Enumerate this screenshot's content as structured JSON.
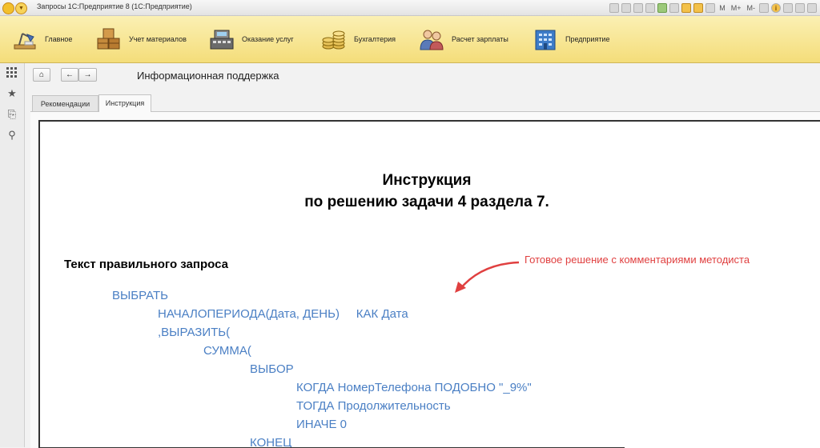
{
  "window": {
    "title": "Запросы 1С:Предприятие 8  (1С:Предприятие)",
    "menu_glyph": "▼",
    "m_label": "M",
    "m_plus_label": "M+",
    "m_minus_label": "M-",
    "info_glyph": "i"
  },
  "sections": [
    {
      "label": "Главное",
      "icon": "desk-lamp-icon"
    },
    {
      "label": "Учет материалов",
      "icon": "boxes-icon"
    },
    {
      "label": "Оказание услуг",
      "icon": "cash-register-icon"
    },
    {
      "label": "Бухгалтерия",
      "icon": "coins-icon"
    },
    {
      "label": "Расчет зарплаты",
      "icon": "people-icon"
    },
    {
      "label": "Предприятие",
      "icon": "building-icon"
    }
  ],
  "left_panel": {
    "apps_icon": "⋮⋮",
    "favorites_icon": "★",
    "history_icon": "⎘",
    "search_icon": "⚲"
  },
  "nav": {
    "home_glyph": "⌂",
    "back_glyph": "←",
    "forward_glyph": "→",
    "page_title": "Информационная поддержка"
  },
  "tabs": [
    {
      "label": "Рекомендации",
      "active": false
    },
    {
      "label": "Инструкция",
      "active": true
    }
  ],
  "document": {
    "title_line1": "Инструкция",
    "title_line2": "по решению задачи 4 раздела 7.",
    "section_heading": "Текст правильного запроса",
    "annotation": "Готовое решение с комментариями методиста",
    "code_lines": [
      "ВЫБРАТЬ",
      "НАЧАЛОПЕРИОДА(Дата, ДЕНЬ)     КАК Дата",
      ",ВЫРАЗИТЬ(",
      "СУММА(",
      "ВЫБОР",
      "КОГДА НомерТелефона ПОДОБНО \"_9%\"",
      "ТОГДА Продолжительность",
      "ИНАЧЕ 0",
      "КОНЕЦ"
    ]
  },
  "colors": {
    "code": "#4a7fc4",
    "annotation": "#e04040",
    "toolbar_bg": "#f6e28f"
  }
}
